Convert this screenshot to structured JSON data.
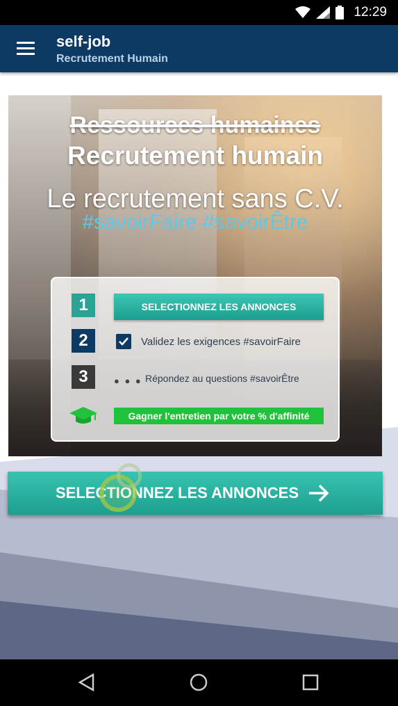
{
  "status_bar": {
    "time": "12:29",
    "icons": [
      "wifi-icon",
      "signal-icon",
      "battery-icon"
    ]
  },
  "app_bar": {
    "title": "self-job",
    "subtitle": "Recrutement Humain",
    "menu_icon": "menu-icon",
    "color": "#0d3a63"
  },
  "hero": {
    "struck_title": "Ressources humaines",
    "title": "Recrutement humain",
    "subtitle": "Le recrutement sans C.V.",
    "tags": "#savoirFaire #savoirÊtre"
  },
  "steps": [
    {
      "number": "1",
      "label": "SELECTIONNEZ LES ANNONCES"
    },
    {
      "number": "2",
      "label": "Validez les exigences #savoirFaire"
    },
    {
      "number": "3",
      "label": "Répondez au questions #savoirÊtre"
    },
    {
      "icon": "graduation-cap-icon",
      "label": "Gagner l'entretien par votre % d'affinité"
    }
  ],
  "cta": {
    "label": "SELECTIONNEZ LES ANNONCES",
    "icon": "arrow-right-icon",
    "color": "#2ab3a2"
  },
  "nav_bar": {
    "icons": [
      "back-icon",
      "home-icon",
      "recents-icon"
    ]
  }
}
